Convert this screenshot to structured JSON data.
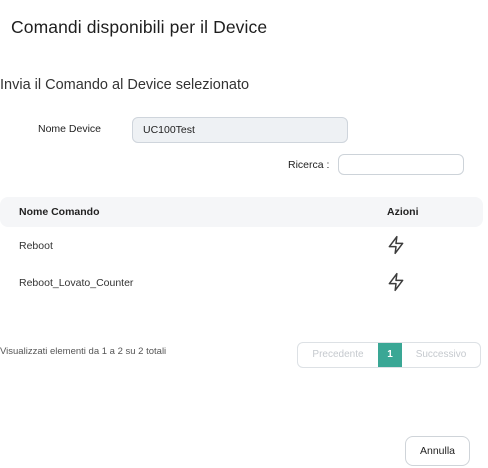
{
  "dialog": {
    "title": "Comandi disponibili per il Device",
    "subtitle": "Invia il Comando al Device selezionato"
  },
  "form": {
    "device_label": "Nome Device",
    "device_value": "UC100Test",
    "search_label": "Ricerca :",
    "search_value": ""
  },
  "table": {
    "headers": {
      "name": "Nome Comando",
      "actions": "Azioni"
    },
    "rows": [
      {
        "name": "Reboot",
        "action_icon": "lightning-icon"
      },
      {
        "name": "Reboot_Lovato_Counter",
        "action_icon": "lightning-icon"
      }
    ]
  },
  "footer": {
    "info": "Visualizzati elementi da 1 a 2 su 2 totali",
    "pagination": {
      "previous": "Precedente",
      "current": "1",
      "next": "Successivo"
    }
  },
  "actions": {
    "cancel": "Annulla"
  },
  "colors": {
    "accent": "#3aa795",
    "header_bg": "#f5f6f8",
    "field_bg": "#eef1f4"
  }
}
